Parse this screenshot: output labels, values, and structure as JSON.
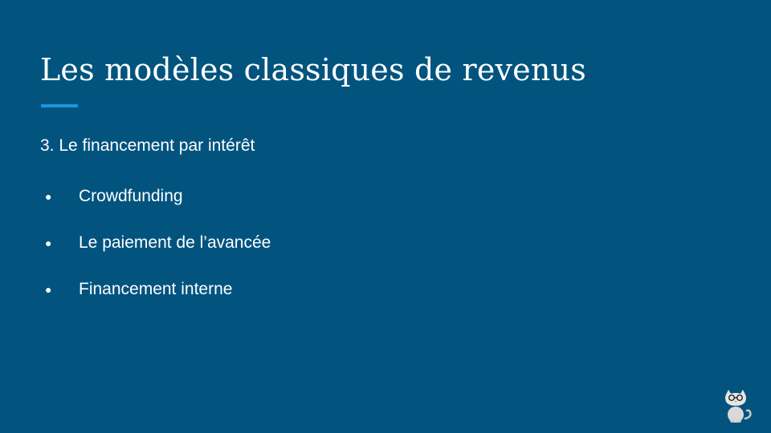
{
  "slide": {
    "title": "Les modèles classiques de revenus",
    "section_heading": "3. Le financement par intérêt",
    "bullets": [
      {
        "marker": "●",
        "text": "Crowdfunding"
      },
      {
        "marker": "●",
        "text": "Le paiement de l’avancée"
      },
      {
        "marker": "●",
        "text": "Financement interne"
      }
    ],
    "mascot_icon": "cat-with-glasses-icon"
  },
  "colors": {
    "background": "#02547f",
    "accent": "#1a95e0",
    "text": "#ffffff"
  }
}
